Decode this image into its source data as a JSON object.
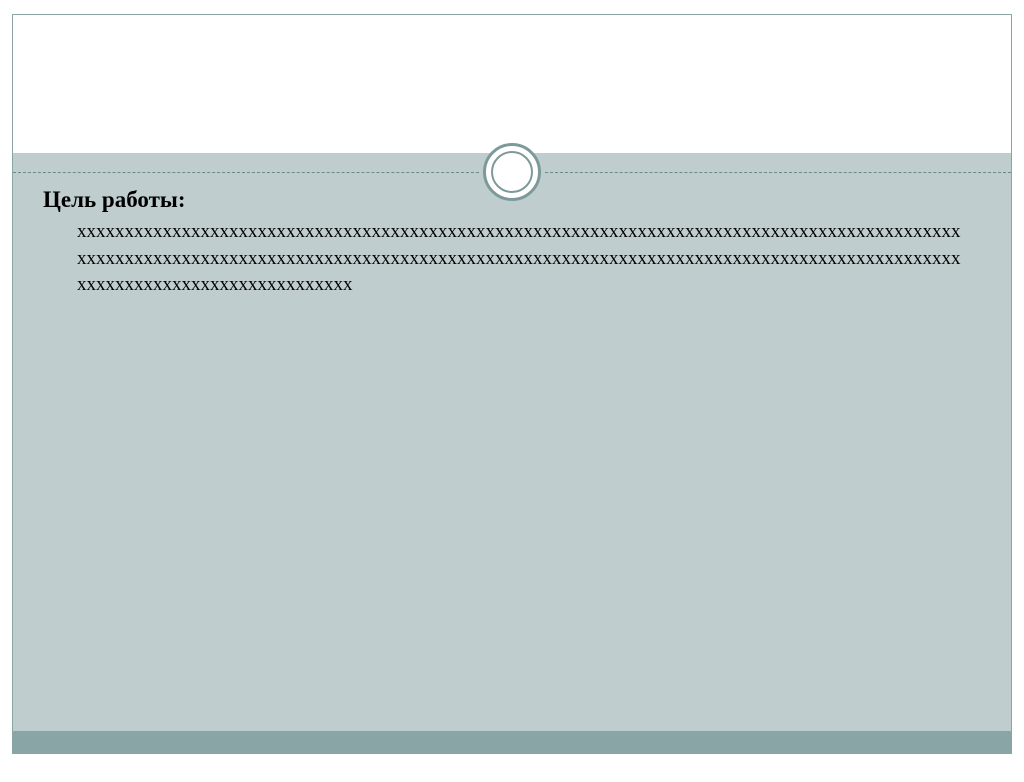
{
  "slide": {
    "heading": "Цель работы:",
    "body": "ххххххххххххххххххххххххххххххххххххххххххххххххххххххххххххххххххххххххххххххххххххххххххххххххххххххххххххххххххххххххххххххххххххххххххххххххххххххххххххххххххххххххххххххххххххххххххххххххххххххххххххххххххххххх"
  },
  "colors": {
    "border": "#8ba5a5",
    "bodyBg": "#bfcdcf",
    "footer": "#89a5a5",
    "ornament": "#7d9999"
  }
}
